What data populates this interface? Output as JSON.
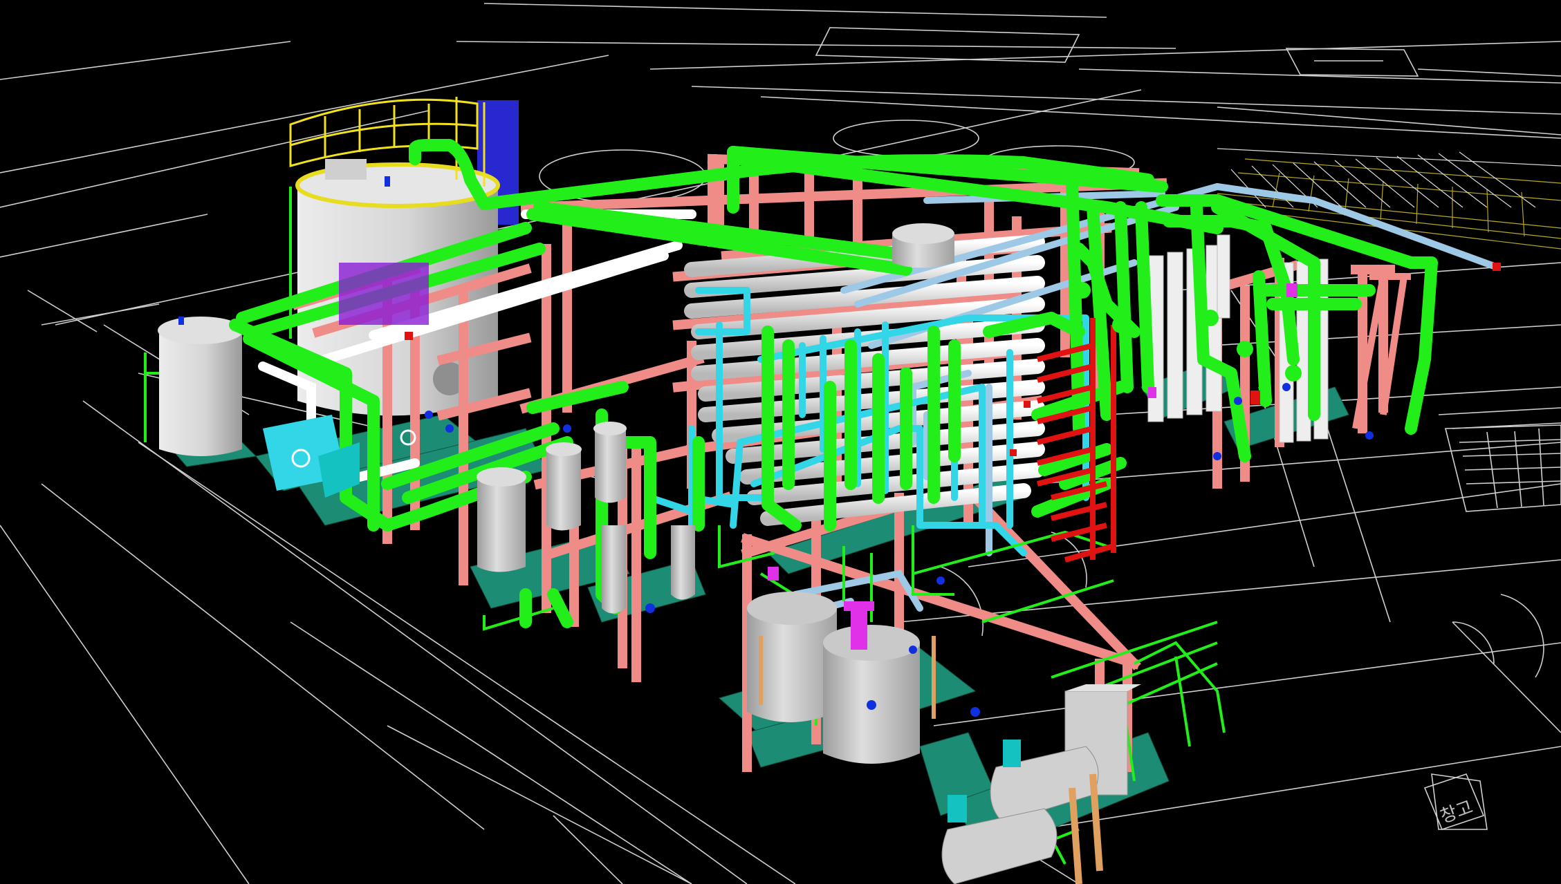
{
  "scene": {
    "description_labels": {
      "room_label": "창고"
    },
    "colors": {
      "background": "#000000",
      "cad_lines": "#d9d9d9",
      "cad_lines_dim": "#8a8a8a",
      "pipe_main": "#22ee1a",
      "pipe_secondary": "#33d6e6",
      "pipe_light": "#9ec9e6",
      "structure": "#f08c88",
      "vessel": "#d8d8d8",
      "vessel_dark": "#a9a9a9",
      "skid": "#1c8c74",
      "platform_rail": "#f2e21e",
      "valve_red": "#e01212",
      "valve_blue": "#1030e0",
      "valve_magenta": "#e030e8",
      "duct_blue": "#2020c8",
      "white_pipe": "#f2f2f2",
      "wood": "#e0a060",
      "cyan_box": "#14c2c2"
    }
  }
}
